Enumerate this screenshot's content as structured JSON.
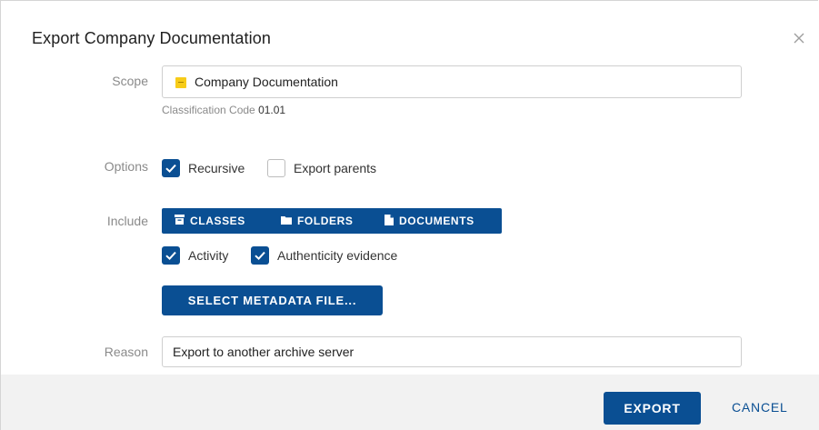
{
  "dialog": {
    "title": "Export Company Documentation",
    "close_icon": "close-icon"
  },
  "scope": {
    "label": "Scope",
    "value": "Company Documentation",
    "icon": "class-icon",
    "icon_color": "#f7cc19",
    "classification_label": "Classification Code",
    "classification_code": "01.01"
  },
  "options": {
    "label": "Options",
    "recursive": {
      "label": "Recursive",
      "checked": true
    },
    "export_parents": {
      "label": "Export parents",
      "checked": false
    }
  },
  "include": {
    "label": "Include",
    "buttons": [
      {
        "label": "CLASSES",
        "icon": "archive-box-icon"
      },
      {
        "label": "FOLDERS",
        "icon": "folder-icon"
      },
      {
        "label": "DOCUMENTS",
        "icon": "document-icon"
      }
    ],
    "activity": {
      "label": "Activity",
      "checked": true
    },
    "authenticity": {
      "label": "Authenticity evidence",
      "checked": true
    },
    "metadata_button": "SELECT METADATA FILE..."
  },
  "reason": {
    "label": "Reason",
    "value": "Export to another archive server"
  },
  "footer": {
    "export_label": "EXPORT",
    "cancel_label": "CANCEL"
  },
  "colors": {
    "primary": "#0a4f93",
    "footer_bg": "#f2f2f2",
    "label_gray": "#8a8a8a"
  }
}
